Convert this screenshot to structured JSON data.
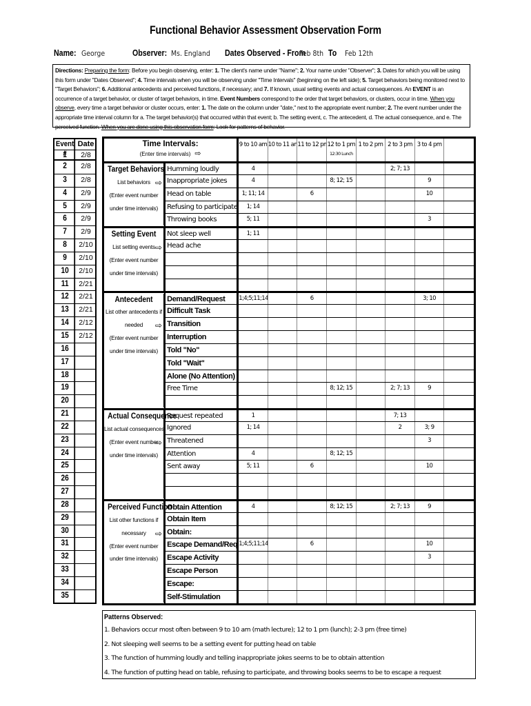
{
  "title": "Functional Behavior Assessment Observation Form",
  "header": {
    "name_label": "Name:",
    "name_value": "George",
    "observer_label": "Observer:",
    "observer_value": "Ms. England",
    "dates_label": "Dates Observed - From",
    "date_from": "Feb 8th",
    "to_label": "To",
    "date_to": "Feb 12th"
  },
  "directions": {
    "label": "Directions:",
    "prep_label": "Preparing the form",
    "p1": ":  Before you begin observing, enter:  ",
    "s1n": "1.",
    "s1": " The client's name under \"Name\"; ",
    "s2n": "2.",
    "s2": " Your name under \"Observer\"; ",
    "s3n": "3.",
    "s3": " Dates for which you will be using this form under \"Dates Observed\"; ",
    "s4n": "4.",
    "s4": " Time intervals when you will be observing under \"Time Intervals\" (beginning on the left side); ",
    "s5n": "5.",
    "s5": " Target behaviors being monitored next to \"Target Behaviors\"; ",
    "s6n": "6.",
    "s6": " Additional antecedents and perceived functions, if necessary; and ",
    "s7n": "7.",
    "s7": " If known, usual setting events and actual consequences.  An ",
    "event_word": "EVENT",
    "event_def": " is an occurrence of a target behavior, or cluster of target behaviors, in time.  ",
    "event_numbers": "Event Numbers",
    "event_numbers_def": " correspond to the order that target behaviors, or clusters, occur in time.  ",
    "observe_label": "When you observe",
    "observe_text": ", every time a target behavior or cluster occurs, enter:  ",
    "o1n": "1.",
    "o1": " The date on the column under \"date,\" next to the appropriate event number; ",
    "o2n": "2.",
    "o2": " The event number under the appropriate time interval column for a. The target behavior(s) that occurred within that event; b. The setting event, c. The antecedent, d. The actual consequence, and e. The perceived function.  ",
    "done_label": "When you are done using this observation form",
    "done_text": ": Look for patterns of behavior."
  },
  "event_table": {
    "headers": [
      "Event #",
      "Date"
    ],
    "rows": [
      {
        "n": "1",
        "date": "2/8"
      },
      {
        "n": "2",
        "date": "2/8"
      },
      {
        "n": "3",
        "date": "2/8"
      },
      {
        "n": "4",
        "date": "2/9"
      },
      {
        "n": "5",
        "date": "2/9"
      },
      {
        "n": "6",
        "date": "2/9"
      },
      {
        "n": "7",
        "date": "2/9"
      },
      {
        "n": "8",
        "date": "2/10"
      },
      {
        "n": "9",
        "date": "2/10"
      },
      {
        "n": "10",
        "date": "2/10"
      },
      {
        "n": "11",
        "date": "2/21"
      },
      {
        "n": "12",
        "date": "2/21"
      },
      {
        "n": "13",
        "date": "2/21"
      },
      {
        "n": "14",
        "date": "2/12"
      },
      {
        "n": "15",
        "date": "2/12"
      },
      {
        "n": "16",
        "date": ""
      },
      {
        "n": "17",
        "date": ""
      },
      {
        "n": "18",
        "date": ""
      },
      {
        "n": "19",
        "date": ""
      },
      {
        "n": "20",
        "date": ""
      },
      {
        "n": "21",
        "date": ""
      },
      {
        "n": "22",
        "date": ""
      },
      {
        "n": "23",
        "date": ""
      },
      {
        "n": "24",
        "date": ""
      },
      {
        "n": "25",
        "date": ""
      },
      {
        "n": "26",
        "date": ""
      },
      {
        "n": "27",
        "date": ""
      },
      {
        "n": "28",
        "date": ""
      },
      {
        "n": "29",
        "date": ""
      },
      {
        "n": "30",
        "date": ""
      },
      {
        "n": "31",
        "date": ""
      },
      {
        "n": "32",
        "date": ""
      },
      {
        "n": "33",
        "date": ""
      },
      {
        "n": "34",
        "date": ""
      },
      {
        "n": "35",
        "date": ""
      }
    ]
  },
  "time_header": {
    "title": "Time Intervals:",
    "subtitle": "(Enter time intervals)",
    "intervals": [
      {
        "label": "9 to 10 am",
        "note": ""
      },
      {
        "label": "10 to 11 am",
        "note": ""
      },
      {
        "label": "11 to 12 pm",
        "note": ""
      },
      {
        "label": "12 to 1 pm",
        "note": "12:30 Lunch"
      },
      {
        "label": "1 to 2 pm",
        "note": ""
      },
      {
        "label": "2 to 3 pm",
        "note": ""
      },
      {
        "label": "3 to 4 pm",
        "note": ""
      },
      {
        "label": "",
        "note": ""
      }
    ]
  },
  "sections": [
    {
      "title": "Target Behaviors",
      "lines": [
        "List behaviors",
        "",
        "(Enter event number",
        "under time intervals)"
      ],
      "arrow_line": 1,
      "rows": [
        {
          "label": "Humming loudly",
          "style": "hand",
          "cells": [
            "4",
            "",
            "",
            "",
            "",
            "2; 7; 13",
            "",
            ""
          ]
        },
        {
          "label": "Inappropriate jokes",
          "style": "hand",
          "cells": [
            "4",
            "",
            "",
            "8; 12; 15",
            "",
            "",
            "9",
            ""
          ]
        },
        {
          "label": "Head on table",
          "style": "hand",
          "cells": [
            "1; 11; 14",
            "",
            "6",
            "",
            "",
            "",
            "10",
            ""
          ]
        },
        {
          "label": "Refusing to participate",
          "style": "hand",
          "cells": [
            "1; 14",
            "",
            "",
            "",
            "",
            "",
            "",
            ""
          ]
        },
        {
          "label": "Throwing books",
          "style": "hand",
          "cells": [
            "5; 11",
            "",
            "",
            "",
            "",
            "",
            "3",
            ""
          ]
        }
      ]
    },
    {
      "title": "Setting Event",
      "lines": [
        "List setting events",
        "",
        "(Enter event number",
        "under time intervals)"
      ],
      "arrow_line": 1,
      "rows": [
        {
          "label": "Not sleep well",
          "style": "hand",
          "cells": [
            "1; 11",
            "",
            "",
            "",
            "",
            "",
            "",
            ""
          ]
        },
        {
          "label": "Head ache",
          "style": "hand",
          "cells": [
            "",
            "",
            "",
            "",
            "",
            "",
            "",
            ""
          ]
        },
        {
          "label": "",
          "style": "hand",
          "cells": [
            "",
            "",
            "",
            "",
            "",
            "",
            "",
            ""
          ]
        },
        {
          "label": "",
          "style": "hand",
          "cells": [
            "",
            "",
            "",
            "",
            "",
            "",
            "",
            ""
          ]
        },
        {
          "label": "",
          "style": "hand",
          "cells": [
            "",
            "",
            "",
            "",
            "",
            "",
            "",
            ""
          ]
        }
      ]
    },
    {
      "title": "Antecedent",
      "lines": [
        "List other antecedents if",
        "needed",
        "",
        "(Enter event number",
        "under time intervals)"
      ],
      "arrow_line": 2,
      "rows": [
        {
          "label": "Demand/Request",
          "style": "print",
          "cells": [
            "1;4;5;11;14",
            "",
            "6",
            "",
            "",
            "",
            "3; 10",
            ""
          ]
        },
        {
          "label": "Difficult Task",
          "style": "print",
          "cells": [
            "",
            "",
            "",
            "",
            "",
            "",
            "",
            ""
          ]
        },
        {
          "label": "Transition",
          "style": "print",
          "cells": [
            "",
            "",
            "",
            "",
            "",
            "",
            "",
            ""
          ]
        },
        {
          "label": "Interruption",
          "style": "print",
          "cells": [
            "",
            "",
            "",
            "",
            "",
            "",
            "",
            ""
          ]
        },
        {
          "label": "Told \"No\"",
          "style": "print",
          "cells": [
            "",
            "",
            "",
            "",
            "",
            "",
            "",
            ""
          ]
        },
        {
          "label": "Told \"Wait\"",
          "style": "print",
          "cells": [
            "",
            "",
            "",
            "",
            "",
            "",
            "",
            ""
          ]
        },
        {
          "label": "Alone (No Attention)",
          "style": "print",
          "cells": [
            "",
            "",
            "",
            "",
            "",
            "",
            "",
            ""
          ]
        },
        {
          "label": "Free Time",
          "style": "hand",
          "cells": [
            "",
            "",
            "",
            "8; 12; 15",
            "",
            "2; 7; 13",
            "9",
            ""
          ]
        },
        {
          "label": "",
          "style": "hand",
          "cells": [
            "",
            "",
            "",
            "",
            "",
            "",
            "",
            ""
          ]
        }
      ]
    },
    {
      "title": "Actual Consequence",
      "lines": [
        "List actual consequences",
        "",
        "(Enter event number",
        "under time intervals)"
      ],
      "arrow_line": 2,
      "rows": [
        {
          "label": "Request repeated",
          "style": "hand",
          "cells": [
            "1",
            "",
            "",
            "",
            "",
            "7; 13",
            "",
            ""
          ]
        },
        {
          "label": "Ignored",
          "style": "hand",
          "cells": [
            "1; 14",
            "",
            "",
            "",
            "",
            "2",
            "3; 9",
            ""
          ]
        },
        {
          "label": "Threatened",
          "style": "hand",
          "cells": [
            "",
            "",
            "",
            "",
            "",
            "",
            "3",
            ""
          ]
        },
        {
          "label": "Attention",
          "style": "hand",
          "cells": [
            "4",
            "",
            "",
            "8; 12; 15",
            "",
            "",
            "",
            ""
          ]
        },
        {
          "label": "Sent away",
          "style": "hand",
          "cells": [
            "5; 11",
            "",
            "6",
            "",
            "",
            "",
            "10",
            ""
          ]
        },
        {
          "label": "",
          "style": "hand",
          "cells": [
            "",
            "",
            "",
            "",
            "",
            "",
            "",
            ""
          ]
        },
        {
          "label": "",
          "style": "hand",
          "cells": [
            "",
            "",
            "",
            "",
            "",
            "",
            "",
            ""
          ]
        }
      ]
    },
    {
      "title": "Perceived Function",
      "lines": [
        "List other functions if",
        "necessary",
        "",
        "(Enter event number",
        "under time intervals)"
      ],
      "arrow_line": 2,
      "rows": [
        {
          "label": "Obtain Attention",
          "style": "print",
          "cells": [
            "4",
            "",
            "",
            "8; 12; 15",
            "",
            "2; 7; 13",
            "9",
            ""
          ]
        },
        {
          "label": "Obtain Item",
          "style": "print",
          "cells": [
            "",
            "",
            "",
            "",
            "",
            "",
            "",
            ""
          ]
        },
        {
          "label": "Obtain:",
          "style": "print",
          "cells": [
            "",
            "",
            "",
            "",
            "",
            "",
            "",
            ""
          ]
        },
        {
          "label": "Escape Demand/Request",
          "style": "print",
          "cells": [
            "1;4;5;11;14",
            "",
            "6",
            "",
            "",
            "",
            "10",
            ""
          ]
        },
        {
          "label": "Escape Activity",
          "style": "print",
          "cells": [
            "",
            "",
            "",
            "",
            "",
            "",
            "3",
            ""
          ]
        },
        {
          "label": "Escape Person",
          "style": "print",
          "cells": [
            "",
            "",
            "",
            "",
            "",
            "",
            "",
            ""
          ]
        },
        {
          "label": "Escape:",
          "style": "print",
          "cells": [
            "",
            "",
            "",
            "",
            "",
            "",
            "",
            ""
          ]
        },
        {
          "label": "Self-Stimulation",
          "style": "print",
          "cells": [
            "",
            "",
            "",
            "",
            "",
            "",
            "",
            ""
          ]
        }
      ]
    }
  ],
  "patterns": {
    "title": "Patterns Observed:",
    "lines": [
      "1. Behaviors occur most often between 9 to 10 am (math lecture); 12 to 1 pm (lunch); 2-3 pm (free time)",
      "2. Not sleeping well seems to be a setting event for putting head on table",
      "3. The function of humming loudly and telling inappropriate jokes seems to be to obtain attention",
      "4. The function of putting head on table, refusing to participate, and throwing books seems to be to escape a request"
    ]
  }
}
